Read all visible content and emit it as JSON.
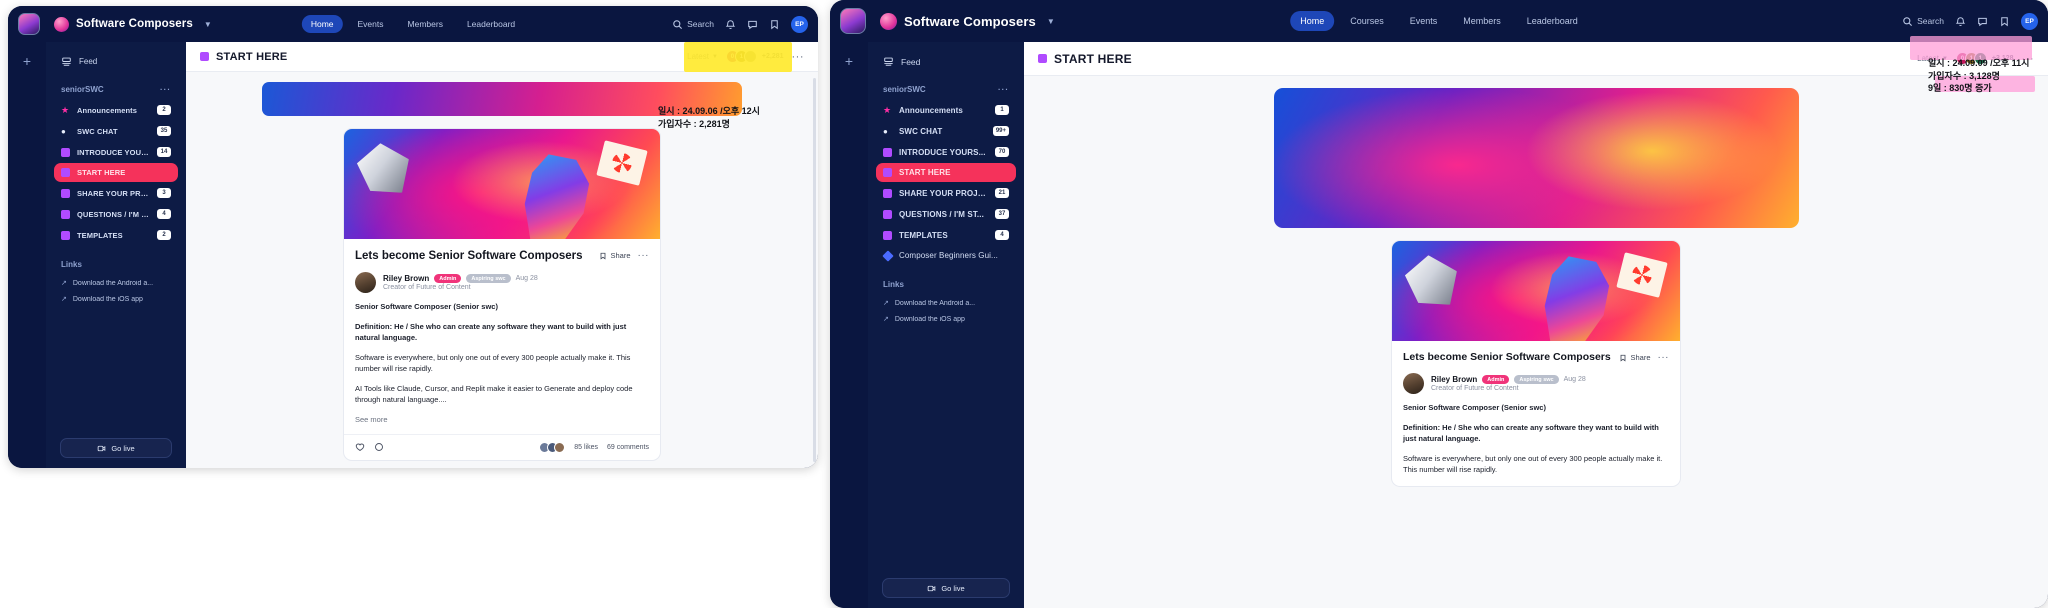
{
  "panels": {
    "left": {
      "topbar": {
        "brand": "Software Composers",
        "nav": [
          {
            "label": "Home",
            "active": true
          },
          {
            "label": "Events",
            "active": false
          },
          {
            "label": "Members",
            "active": false
          },
          {
            "label": "Leaderboard",
            "active": false
          }
        ],
        "search_label": "Search",
        "avatar_initials": "EP"
      },
      "sidebar": {
        "feed_label": "Feed",
        "group_title": "seniorSWC",
        "group_menu": "···",
        "channels": [
          {
            "label": "Announcements",
            "badge": "2",
            "icon": "star-icon",
            "active": false
          },
          {
            "label": "SWC CHAT",
            "badge": "35",
            "icon": "chat-bubble-icon",
            "active": false
          },
          {
            "label": "INTRODUCE YOURS...",
            "badge": "14",
            "icon": "square-icon",
            "active": false
          },
          {
            "label": "START HERE",
            "badge": "",
            "icon": "square-icon",
            "active": true
          },
          {
            "label": "SHARE YOUR PROJE...",
            "badge": "3",
            "icon": "square-icon",
            "active": false
          },
          {
            "label": "QUESTIONS / I'M ST...",
            "badge": "4",
            "icon": "square-icon",
            "active": false
          },
          {
            "label": "TEMPLATES",
            "badge": "2",
            "icon": "square-icon",
            "active": false
          }
        ],
        "links_title": "Links",
        "links": [
          {
            "label": "Download the Android a..."
          },
          {
            "label": "Download the iOS app"
          }
        ],
        "go_live_label": "Go live"
      },
      "content": {
        "header_title": "START HERE",
        "sort_label": "Latest",
        "facepile": [
          {
            "text": "0",
            "color": "#c2185b"
          },
          {
            "text": "1",
            "color": "#7a6a10"
          },
          {
            "text": "",
            "color": "#9e9e6a"
          }
        ],
        "facepile_more": "+2,281",
        "kebab": "···"
      },
      "post": {
        "title": "Lets become Senior Software Composers",
        "share_label": "Share",
        "kebab": "···",
        "author_name": "Riley Brown",
        "tag_admin": "Admin",
        "tag_role": "Aspiring swc",
        "date": "Aug 28",
        "author_subtitle": "Creator of Future of Content",
        "paragraphs": [
          {
            "text": "Senior Software Composer (Senior swc)",
            "bold": true
          },
          {
            "text": "Definition: He / She who can create any software they want to build with just natural language.",
            "bold": true
          },
          {
            "text": "Software is everywhere, but only one out of every 300 people actually make it. This number will rise rapidly.",
            "bold": false
          },
          {
            "text": "AI Tools like Claude, Cursor, and Replit make it easier to Generate and deploy code through natural language....",
            "bold": false
          }
        ],
        "see_more": "See more",
        "likes": "85 likes",
        "comments": "69 comments"
      },
      "annotation": {
        "line1": "일시 : 24.09.06 /오후 12시",
        "line2": "가입자수 : 2,281명",
        "highlight_color": "#ffe92e"
      }
    },
    "right": {
      "topbar": {
        "brand": "Software Composers",
        "nav": [
          {
            "label": "Home",
            "active": true
          },
          {
            "label": "Courses",
            "active": false
          },
          {
            "label": "Events",
            "active": false
          },
          {
            "label": "Members",
            "active": false
          },
          {
            "label": "Leaderboard",
            "active": false
          }
        ],
        "search_label": "Search",
        "avatar_initials": "EP"
      },
      "sidebar": {
        "feed_label": "Feed",
        "group_title": "seniorSWC",
        "group_menu": "···",
        "channels": [
          {
            "label": "Announcements",
            "badge": "1",
            "icon": "star-icon",
            "active": false
          },
          {
            "label": "SWC CHAT",
            "badge": "99+",
            "icon": "chat-bubble-icon",
            "active": false
          },
          {
            "label": "INTRODUCE YOURS...",
            "badge": "70",
            "icon": "square-icon",
            "active": false
          },
          {
            "label": "START HERE",
            "badge": "",
            "icon": "square-icon",
            "active": true
          },
          {
            "label": "SHARE YOUR PROJE...",
            "badge": "21",
            "icon": "square-icon",
            "active": false
          },
          {
            "label": "QUESTIONS / I'M ST...",
            "badge": "37",
            "icon": "square-icon",
            "active": false
          },
          {
            "label": "TEMPLATES",
            "badge": "4",
            "icon": "square-icon",
            "active": false
          },
          {
            "label": "Composer Beginners Gui...",
            "badge": "",
            "icon": "diamond-icon",
            "active": false
          }
        ],
        "links_title": "Links",
        "links": [
          {
            "label": "Download the Android a..."
          },
          {
            "label": "Download the iOS app"
          }
        ],
        "go_live_label": "Go live"
      },
      "content": {
        "header_title": "START HERE",
        "sort_label": "Latest",
        "facepile": [
          {
            "text": "0",
            "color": "#c2185b"
          },
          {
            "text": "1",
            "color": "#8a6d1a"
          },
          {
            "text": "1",
            "color": "#1b6b4a"
          }
        ],
        "facepile_more": "+3,128",
        "kebab": "···"
      },
      "post": {
        "title": "Lets become Senior Software Composers",
        "share_label": "Share",
        "kebab": "···",
        "author_name": "Riley Brown",
        "tag_admin": "Admin",
        "tag_role": "Aspiring swc",
        "date": "Aug 28",
        "author_subtitle": "Creator of Future of Content",
        "paragraphs": [
          {
            "text": "Senior Software Composer (Senior swc)",
            "bold": true
          },
          {
            "text": "Definition: He / She who can create any software they want to build with just natural language.",
            "bold": true
          },
          {
            "text": "Software is everywhere, but only one out of every 300 people actually make it. This number will rise rapidly.",
            "bold": false
          }
        ]
      },
      "annotation": {
        "line1": "일시 : 24.09.09 /오후 11시",
        "line2": "가입자수 : 3,128명",
        "line3": "9일 : 830명 증가",
        "highlight_color": "#ff9ed8"
      }
    }
  }
}
